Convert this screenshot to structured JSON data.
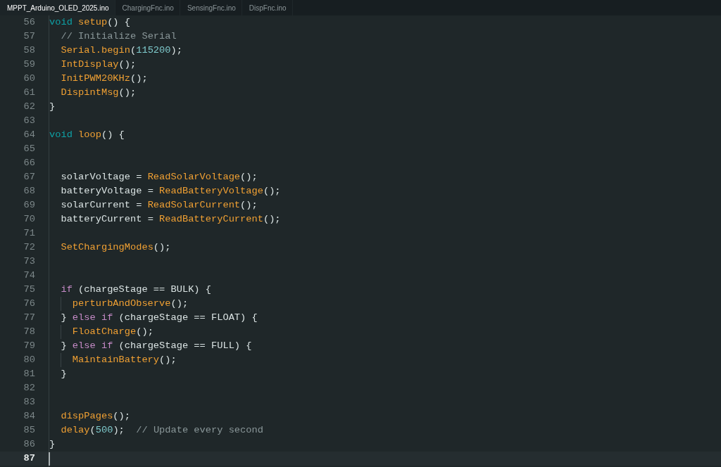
{
  "tabs": [
    {
      "label": "MPPT_Arduino_OLED_2025.ino",
      "selected": true
    },
    {
      "label": "ChargingFnc.ino",
      "selected": false
    },
    {
      "label": "SensingFnc.ino",
      "selected": false
    },
    {
      "label": "DispFnc.ino",
      "selected": false
    }
  ],
  "editor": {
    "lines": [
      {
        "number": "56",
        "current": false,
        "code": [
          {
            "kind": "keyword",
            "text": "void "
          },
          {
            "kind": "function",
            "text": "setup"
          },
          {
            "kind": "plain",
            "text": "() {"
          }
        ],
        "children": [
          {
            "number": "57",
            "current": false,
            "code": [
              {
                "kind": "comment",
                "text": "// Initialize Serial"
              }
            ]
          },
          {
            "number": "58",
            "current": false,
            "code": [
              {
                "kind": "function",
                "text": "Serial.begin"
              },
              {
                "kind": "plain",
                "text": "("
              },
              {
                "kind": "number",
                "text": "115200"
              },
              {
                "kind": "plain",
                "text": ");"
              }
            ]
          },
          {
            "number": "59",
            "current": false,
            "code": [
              {
                "kind": "function",
                "text": "IntDisplay"
              },
              {
                "kind": "plain",
                "text": "();"
              }
            ]
          },
          {
            "number": "60",
            "current": false,
            "code": [
              {
                "kind": "function",
                "text": "InitPWM20KHz"
              },
              {
                "kind": "plain",
                "text": "();"
              }
            ]
          },
          {
            "number": "61",
            "current": false,
            "code": [
              {
                "kind": "function",
                "text": "DispintMsg"
              },
              {
                "kind": "plain",
                "text": "();"
              }
            ]
          }
        ]
      },
      {
        "number": "62",
        "current": false,
        "code": [
          {
            "kind": "plain",
            "text": "}"
          }
        ]
      },
      {
        "number": "63",
        "current": false
      },
      {
        "number": "64",
        "current": false,
        "code": [
          {
            "kind": "keyword",
            "text": "void "
          },
          {
            "kind": "function",
            "text": "loop"
          },
          {
            "kind": "plain",
            "text": "() {"
          }
        ],
        "children": [
          {
            "number": "65",
            "current": false
          },
          {
            "number": "66",
            "current": false
          },
          {
            "number": "67",
            "current": false,
            "code": [
              {
                "kind": "plain",
                "text": "solarVoltage = "
              },
              {
                "kind": "function",
                "text": "ReadSolarVoltage"
              },
              {
                "kind": "plain",
                "text": "();"
              }
            ]
          },
          {
            "number": "68",
            "current": false,
            "code": [
              {
                "kind": "plain",
                "text": "batteryVoltage = "
              },
              {
                "kind": "function",
                "text": "ReadBatteryVoltage"
              },
              {
                "kind": "plain",
                "text": "();"
              }
            ]
          },
          {
            "number": "69",
            "current": false,
            "code": [
              {
                "kind": "plain",
                "text": "solarCurrent = "
              },
              {
                "kind": "function",
                "text": "ReadSolarCurrent"
              },
              {
                "kind": "plain",
                "text": "();"
              }
            ]
          },
          {
            "number": "70",
            "current": false,
            "code": [
              {
                "kind": "plain",
                "text": "batteryCurrent = "
              },
              {
                "kind": "function",
                "text": "ReadBatteryCurrent"
              },
              {
                "kind": "plain",
                "text": "();"
              }
            ]
          },
          {
            "number": "71",
            "current": false
          },
          {
            "number": "72",
            "current": false,
            "code": [
              {
                "kind": "function",
                "text": "SetChargingModes"
              },
              {
                "kind": "plain",
                "text": "();"
              }
            ]
          },
          {
            "number": "73",
            "current": false
          },
          {
            "number": "74",
            "current": false
          },
          {
            "number": "75",
            "current": false,
            "code": [
              {
                "kind": "control",
                "text": "if"
              },
              {
                "kind": "plain",
                "text": " (chargeStage == BULK) {"
              }
            ],
            "children": [
              {
                "number": "76",
                "current": false,
                "code": [
                  {
                    "kind": "function",
                    "text": "perturbAndObserve"
                  },
                  {
                    "kind": "plain",
                    "text": "();"
                  }
                ]
              }
            ]
          },
          {
            "number": "77",
            "current": false,
            "code": [
              {
                "kind": "plain",
                "text": "} "
              },
              {
                "kind": "control",
                "text": "else if"
              },
              {
                "kind": "plain",
                "text": " (chargeStage == FLOAT) {"
              }
            ],
            "children": [
              {
                "number": "78",
                "current": false,
                "code": [
                  {
                    "kind": "function",
                    "text": "FloatCharge"
                  },
                  {
                    "kind": "plain",
                    "text": "();"
                  }
                ]
              }
            ]
          },
          {
            "number": "79",
            "current": false,
            "code": [
              {
                "kind": "plain",
                "text": "} "
              },
              {
                "kind": "control",
                "text": "else if"
              },
              {
                "kind": "plain",
                "text": " (chargeStage == FULL) {"
              }
            ],
            "children": [
              {
                "number": "80",
                "current": false,
                "code": [
                  {
                    "kind": "function",
                    "text": "MaintainBattery"
                  },
                  {
                    "kind": "plain",
                    "text": "();"
                  }
                ]
              }
            ]
          },
          {
            "number": "81",
            "current": false,
            "code": [
              {
                "kind": "plain",
                "text": "}"
              }
            ]
          },
          {
            "number": "82",
            "current": false
          },
          {
            "number": "83",
            "current": false
          },
          {
            "number": "84",
            "current": false,
            "code": [
              {
                "kind": "function",
                "text": "dispPages"
              },
              {
                "kind": "plain",
                "text": "();"
              }
            ]
          },
          {
            "number": "85",
            "current": false,
            "code": [
              {
                "kind": "function",
                "text": "delay"
              },
              {
                "kind": "plain",
                "text": "("
              },
              {
                "kind": "number",
                "text": "500"
              },
              {
                "kind": "plain",
                "text": ");  "
              },
              {
                "kind": "comment",
                "text": "// Update every second"
              }
            ]
          }
        ]
      },
      {
        "number": "86",
        "current": false,
        "code": [
          {
            "kind": "plain",
            "text": "}"
          }
        ]
      },
      {
        "number": "87",
        "current": true
      }
    ]
  }
}
